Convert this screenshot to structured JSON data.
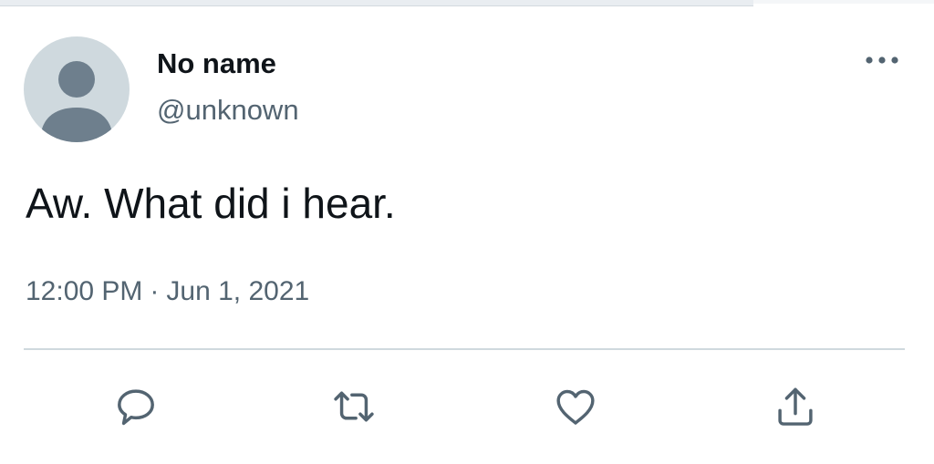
{
  "tweet": {
    "author": {
      "display_name": "No name",
      "handle": "@unknown",
      "avatar_icon": "default-profile-icon"
    },
    "text": "Aw. What did i hear.",
    "time": "12:00 PM",
    "date": "Jun 1, 2021",
    "separator": "·"
  },
  "actions": {
    "reply_icon": "speech-bubble-icon",
    "retweet_icon": "retweet-arrows-icon",
    "like_icon": "heart-icon",
    "share_icon": "upload-share-icon"
  },
  "colors": {
    "text_primary": "#0f1419",
    "text_secondary": "#536471",
    "divider": "#cfd9de",
    "avatar_bg": "#cfd9de",
    "avatar_fg": "#6e7f8d"
  }
}
